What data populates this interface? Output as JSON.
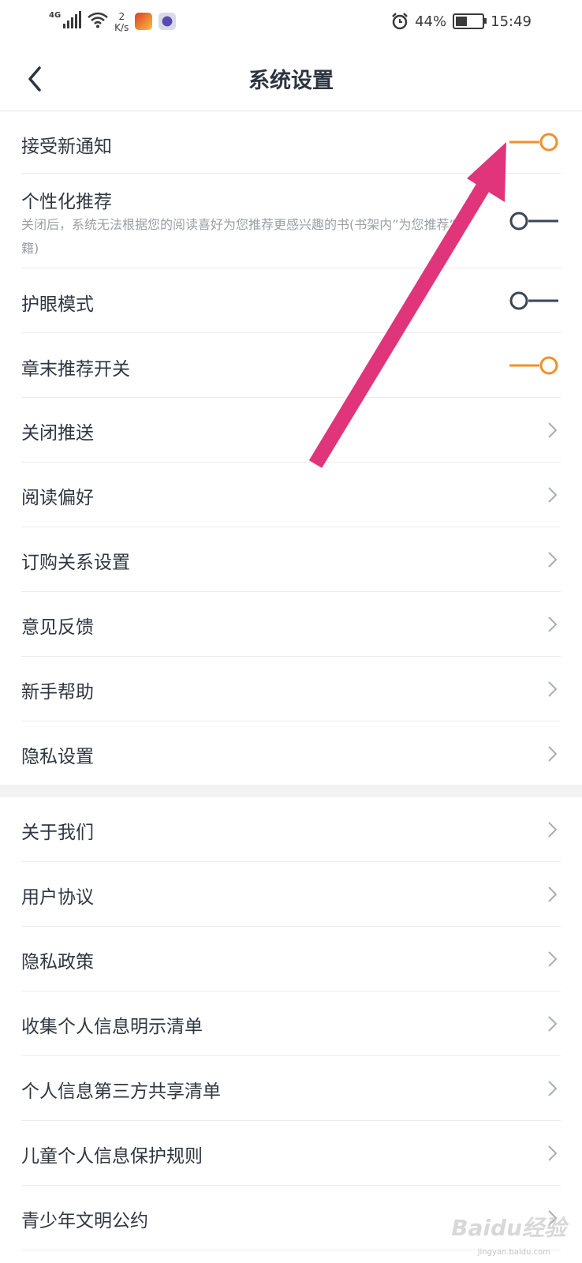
{
  "status_bar": {
    "network": "4G",
    "speed_value": "2",
    "speed_unit": "K/s",
    "battery": "44%",
    "battery_level": 0.44,
    "time": "15:49"
  },
  "header": {
    "title": "系统设置"
  },
  "settings": {
    "notify": {
      "label": "接受新通知",
      "on": true
    },
    "personalized": {
      "label": "个性化推荐",
      "desc": "关闭后，系统无法根据您的阅读喜好为您推荐更感兴趣的书(书架内”为您推荐”书籍)",
      "on": false
    },
    "eye_care": {
      "label": "护眼模式",
      "on": false
    },
    "chapter_end": {
      "label": "章末推荐开关",
      "on": true
    }
  },
  "nav_items": [
    "关闭推送",
    "阅读偏好",
    "订购关系设置",
    "意见反馈",
    "新手帮助",
    "隐私设置"
  ],
  "about_items": [
    "关于我们",
    "用户协议",
    "隐私政策",
    "收集个人信息明示清单",
    "个人信息第三方共享清单",
    "儿童个人信息保护规则",
    "青少年文明公约"
  ],
  "watermark": {
    "main": "Baidu经验",
    "sub": "jingyan.baidu.com"
  },
  "colors": {
    "toggle_on": "#f0902a",
    "toggle_off": "#3a4656",
    "annotation_arrow": "#e0357a"
  }
}
